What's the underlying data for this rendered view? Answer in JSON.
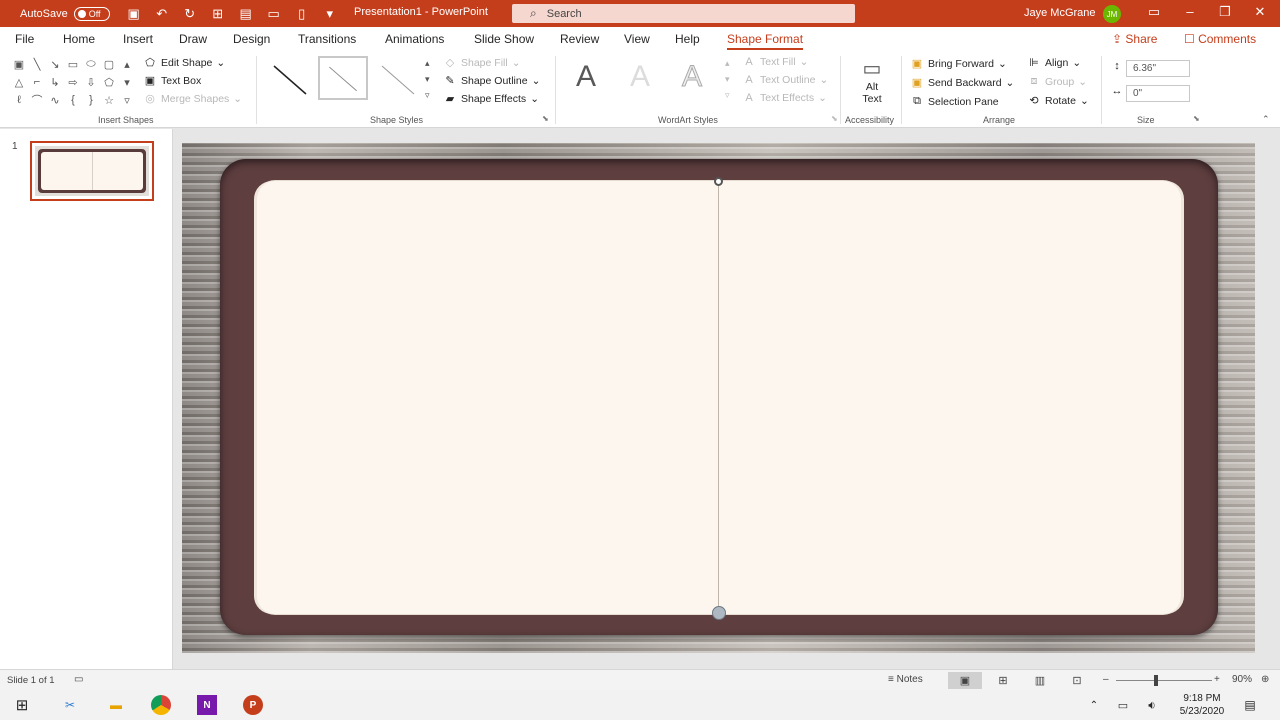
{
  "title_bar": {
    "autosave_label": "AutoSave",
    "autosave_state": "Off",
    "document_title": "Presentation1 - PowerPoint",
    "search_placeholder": "Search",
    "user_name": "Jaye McGrane",
    "user_initials": "JM",
    "accent_color": "#c43e1c"
  },
  "menu": {
    "tabs": [
      "File",
      "Home",
      "Insert",
      "Draw",
      "Design",
      "Transitions",
      "Animations",
      "Slide Show",
      "Review",
      "View",
      "Help",
      "Shape Format"
    ],
    "active_tab": "Shape Format",
    "share_label": "Share",
    "comments_label": "Comments"
  },
  "ribbon": {
    "insert_shapes": {
      "label": "Insert Shapes",
      "edit_shape": "Edit Shape",
      "text_box": "Text Box",
      "merge_shapes": "Merge Shapes"
    },
    "shape_styles": {
      "label": "Shape Styles",
      "shape_fill": "Shape Fill",
      "shape_outline": "Shape Outline",
      "shape_effects": "Shape Effects"
    },
    "wordart_styles": {
      "label": "WordArt Styles",
      "letter": "A",
      "text_fill": "Text Fill",
      "text_outline": "Text Outline",
      "text_effects": "Text Effects"
    },
    "accessibility": {
      "label": "Accessibility",
      "alt_text_line1": "Alt",
      "alt_text_line2": "Text"
    },
    "arrange": {
      "label": "Arrange",
      "bring_forward": "Bring Forward",
      "send_backward": "Send Backward",
      "selection_pane": "Selection Pane",
      "align": "Align",
      "group": "Group",
      "rotate": "Rotate"
    },
    "size": {
      "label": "Size",
      "height": "6.36\"",
      "width": "0\""
    }
  },
  "slides_pane": {
    "slide_number": "1"
  },
  "status_bar": {
    "slide_info": "Slide 1 of 1",
    "notes_label": "Notes",
    "zoom_level": "90%"
  },
  "taskbar": {
    "time": "9:18 PM",
    "date": "5/23/2020"
  }
}
